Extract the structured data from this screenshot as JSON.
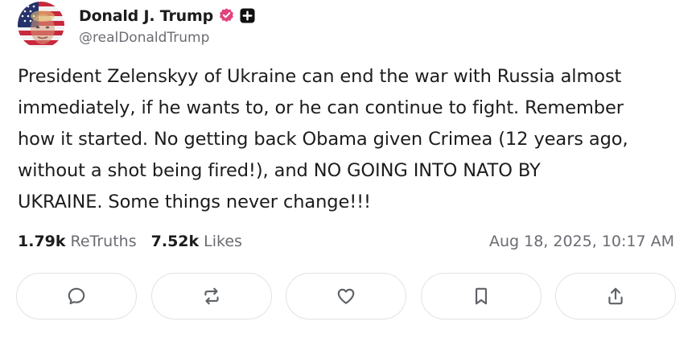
{
  "author": {
    "display_name": "Donald J. Trump",
    "handle": "@realDonaldTrump",
    "verified_icon": "verified-badge-icon",
    "verified_color": "#e0447d",
    "plus_icon": "plus-badge-icon"
  },
  "post": {
    "text": "President Zelenskyy of Ukraine can end the war with Russia almost\nimmediately, if he wants to, or he can continue to fight. Remember\nhow it started. No getting back Obama given Crimea (12 years ago,\nwithout a shot being fired!), and NO GOING INTO NATO BY\nUKRAINE. Some things never change!!!"
  },
  "stats": {
    "retruths_count": "1.79k",
    "retruths_label": "ReTruths",
    "likes_count": "7.52k",
    "likes_label": "Likes",
    "timestamp": "Aug 18, 2025, 10:17 AM"
  },
  "actions": [
    {
      "name": "reply",
      "icon": "comment-icon"
    },
    {
      "name": "retruth",
      "icon": "repost-icon"
    },
    {
      "name": "like",
      "icon": "heart-icon"
    },
    {
      "name": "bookmark",
      "icon": "bookmark-icon"
    },
    {
      "name": "share",
      "icon": "share-icon"
    }
  ],
  "colors": {
    "text_primary": "#1c1c1e",
    "text_secondary": "#6b6b73",
    "border": "#e2e2e6"
  }
}
